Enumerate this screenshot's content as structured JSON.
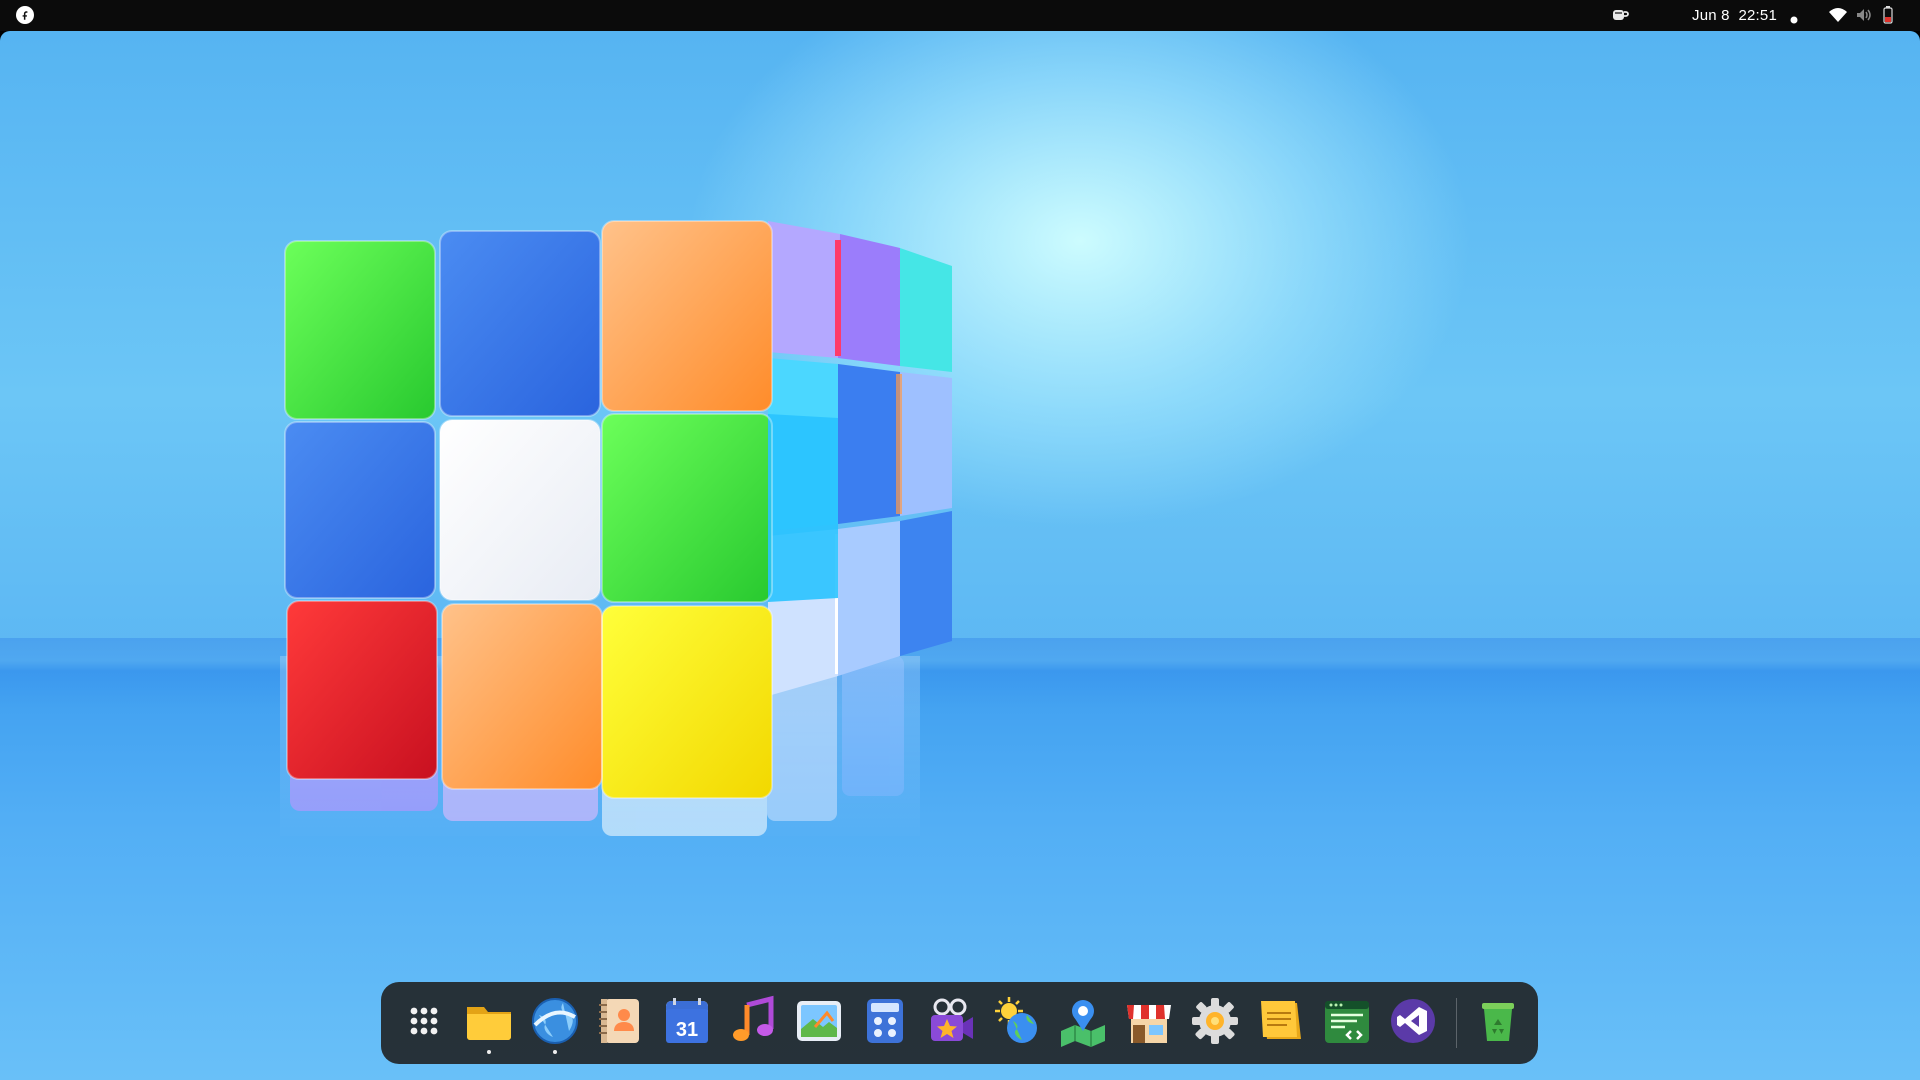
{
  "topbar": {
    "date": "Jun 8",
    "time": "22:51",
    "tray_icons": [
      "coffee-cup-icon",
      "notification-dot-icon",
      "wifi-icon",
      "volume-icon",
      "battery-icon"
    ]
  },
  "desktop": {
    "wallpaper": "rubiks-cube-wallpaper"
  },
  "dock": {
    "items": [
      {
        "name": "show-apps",
        "icon": "app-grid-icon",
        "running": false
      },
      {
        "name": "files",
        "icon": "folder-icon",
        "running": true
      },
      {
        "name": "web-browser",
        "icon": "globe-icon",
        "running": true
      },
      {
        "name": "contacts",
        "icon": "contacts-icon",
        "running": false
      },
      {
        "name": "calendar",
        "icon": "calendar-icon",
        "label": "31",
        "running": false
      },
      {
        "name": "music",
        "icon": "music-note-icon",
        "running": false
      },
      {
        "name": "image-viewer",
        "icon": "photo-icon",
        "running": false
      },
      {
        "name": "calculator",
        "icon": "calculator-icon",
        "running": false
      },
      {
        "name": "video-editor",
        "icon": "video-camera-icon",
        "running": false
      },
      {
        "name": "weather",
        "icon": "weather-icon",
        "running": false
      },
      {
        "name": "maps",
        "icon": "map-pin-icon",
        "running": false
      },
      {
        "name": "software-store",
        "icon": "store-icon",
        "running": false
      },
      {
        "name": "settings",
        "icon": "gear-icon",
        "running": false
      },
      {
        "name": "notes",
        "icon": "sticky-note-icon",
        "running": false
      },
      {
        "name": "code-editor",
        "icon": "code-editor-icon",
        "running": false
      },
      {
        "name": "visual-studio",
        "icon": "visual-studio-icon",
        "running": false
      },
      {
        "name": "trash",
        "icon": "trash-icon",
        "running": false
      }
    ]
  },
  "colors": {
    "topbar_bg": "#0b0b0b",
    "dock_bg": "#1e1e1e",
    "wallpaper_blue": "#56b4f2"
  }
}
